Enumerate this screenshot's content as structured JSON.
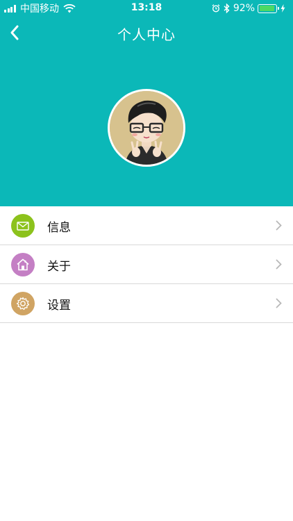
{
  "status_bar": {
    "carrier": "中国移动",
    "time": "13:18",
    "battery_percent": "92%",
    "battery_level": 0.92,
    "icons": [
      "signal-icon",
      "wifi-icon",
      "alarm-icon",
      "bluetooth-icon",
      "battery-icon",
      "charging-icon"
    ]
  },
  "nav": {
    "title": "个人中心",
    "back_icon": "chevron-left-icon"
  },
  "colors": {
    "header_bg": "#0bb8b8",
    "message_icon_bg": "#8cc21c",
    "about_icon_bg": "#c47fc4",
    "settings_icon_bg": "#d0a463"
  },
  "menu": {
    "items": [
      {
        "label": "信息",
        "icon": "mail-icon"
      },
      {
        "label": "关于",
        "icon": "home-icon"
      },
      {
        "label": "设置",
        "icon": "gear-icon"
      }
    ]
  }
}
